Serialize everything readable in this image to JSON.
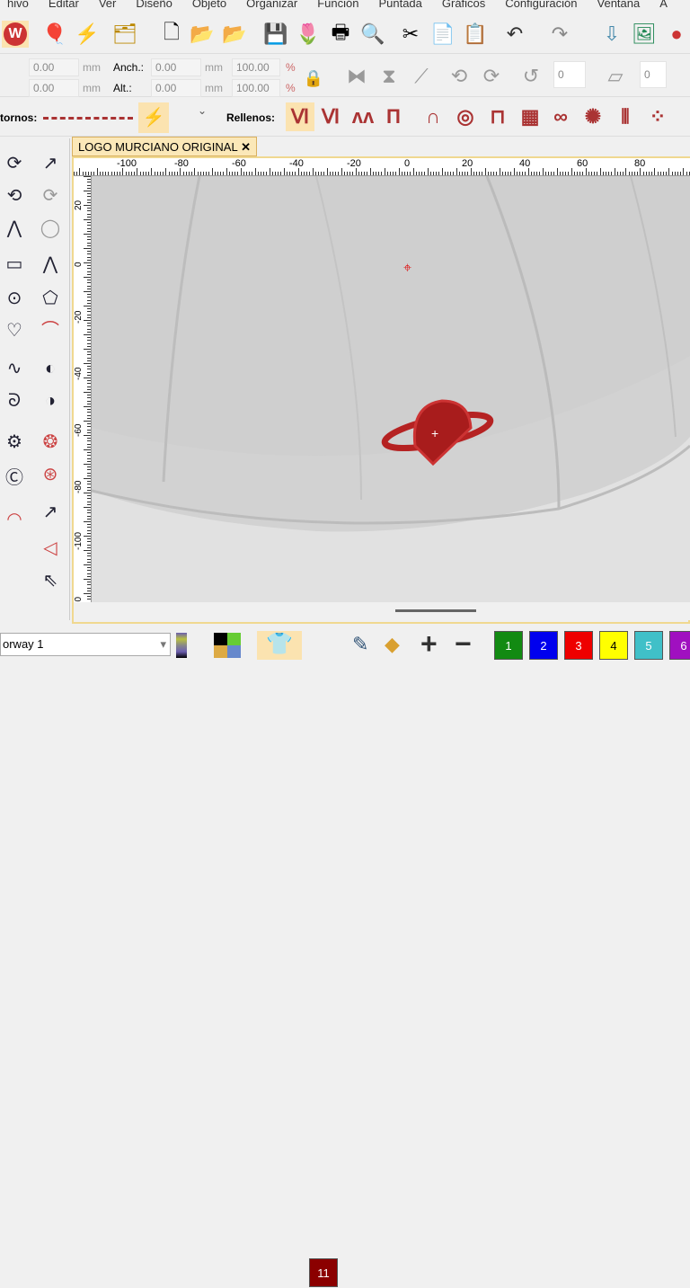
{
  "menu": [
    "hivo",
    "Editar",
    "Ver",
    "Diseño",
    "Objeto",
    "Organizar",
    "Función",
    "Puntada",
    "Gráficos",
    "Configuración",
    "Ventana",
    "A"
  ],
  "fields": {
    "x_value": "0.00",
    "y_value": "0.00",
    "width_label": "Anch.:",
    "height_label": "Alt.:",
    "width_value": "0.00",
    "height_value": "0.00",
    "width_pct": "100.00",
    "height_pct": "100.00",
    "unit": "mm",
    "pct": "%",
    "rotation": "0",
    "slant": "0"
  },
  "stitch": {
    "outlines_label": "tornos:",
    "fills_label": "Rellenos:"
  },
  "tab": {
    "title": "LOGO MURCIANO ORIGINAL",
    "close": "✕"
  },
  "ruler": {
    "h": [
      "-100",
      "-80",
      "-60",
      "-40",
      "-20",
      "0",
      "20",
      "40",
      "60",
      "80"
    ],
    "v": [
      "20",
      "0",
      "-20",
      "-40",
      "-60",
      "-80",
      "-100",
      "20"
    ]
  },
  "bottom": {
    "palette": "orway 1",
    "current_color": "11",
    "colors": [
      {
        "n": "1",
        "c": "#128a12"
      },
      {
        "n": "2",
        "c": "#0000ee"
      },
      {
        "n": "3",
        "c": "#ee0000"
      },
      {
        "n": "4",
        "c": "#ffff00"
      },
      {
        "n": "5",
        "c": "#40c0c8"
      },
      {
        "n": "6",
        "c": "#a010c0"
      }
    ]
  }
}
